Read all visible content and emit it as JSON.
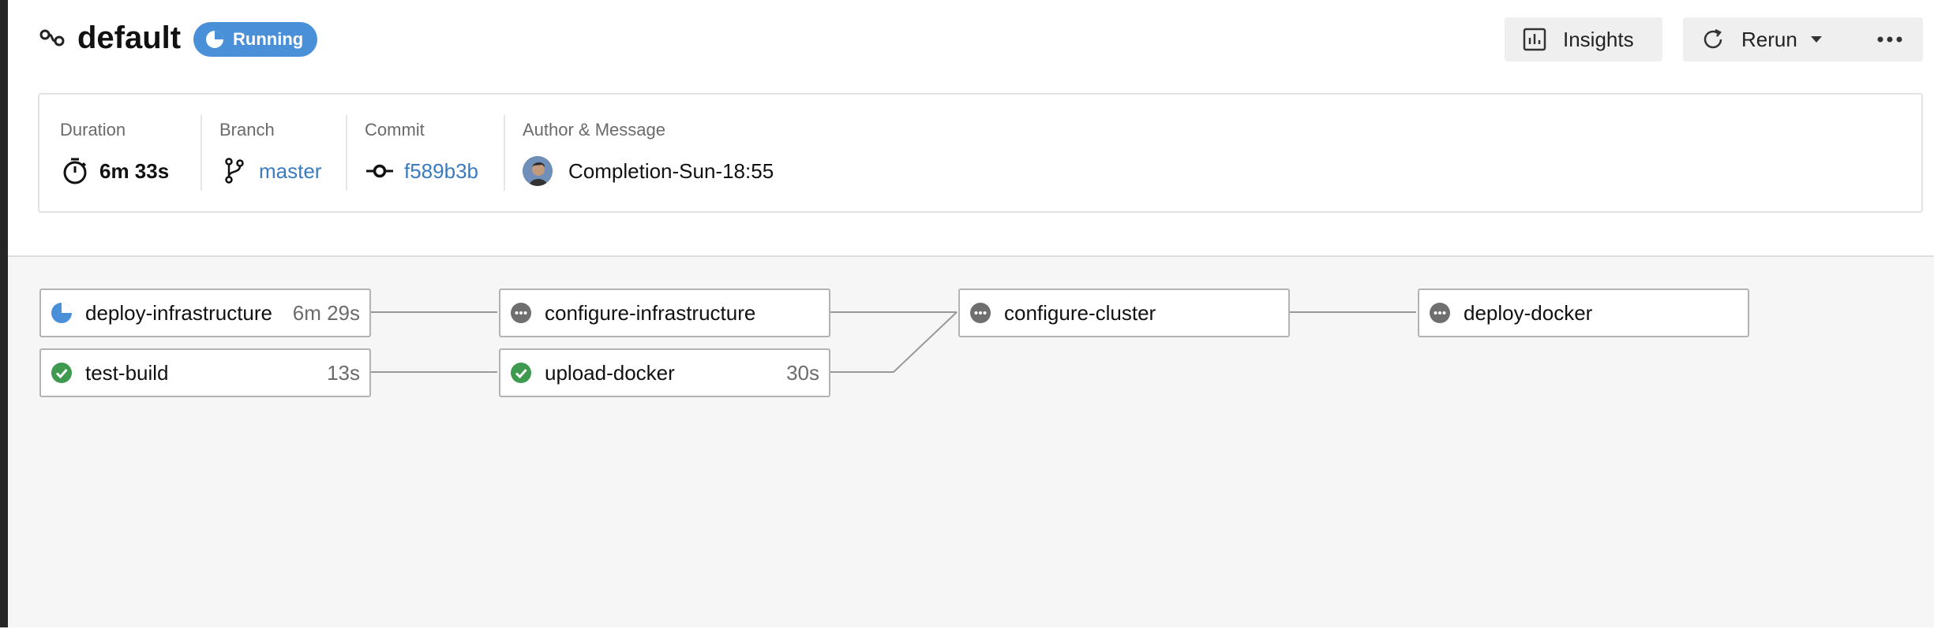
{
  "pipeline": {
    "name": "default",
    "status": "Running"
  },
  "toolbar": {
    "insights_label": "Insights",
    "rerun_label": "Rerun",
    "more_label": "•••"
  },
  "info": {
    "duration": {
      "label": "Duration",
      "value": "6m 33s"
    },
    "branch": {
      "label": "Branch",
      "value": "master"
    },
    "commit": {
      "label": "Commit",
      "value": "f589b3b"
    },
    "author": {
      "label": "Author & Message",
      "value": "Completion-Sun-18:55"
    }
  },
  "jobs": [
    {
      "name": "deploy-infrastructure",
      "duration": "6m 29s",
      "status": "running"
    },
    {
      "name": "test-build",
      "duration": "13s",
      "status": "success"
    },
    {
      "name": "configure-infrastructure",
      "duration": "",
      "status": "pending"
    },
    {
      "name": "upload-docker",
      "duration": "30s",
      "status": "success"
    },
    {
      "name": "configure-cluster",
      "duration": "",
      "status": "pending"
    },
    {
      "name": "deploy-docker",
      "duration": "",
      "status": "pending"
    }
  ],
  "colors": {
    "running": "#4a90d9",
    "success": "#3d9a4e",
    "pending": "#6f6f6f",
    "link": "#3a7bbf"
  },
  "icons": {
    "pipeline": "pipeline-icon",
    "badge": "spinner-icon",
    "insights": "bar-chart-icon",
    "rerun": "refresh-icon",
    "more": "ellipsis-icon",
    "duration": "stopwatch-icon",
    "branch": "git-branch-icon",
    "commit": "git-commit-icon"
  }
}
